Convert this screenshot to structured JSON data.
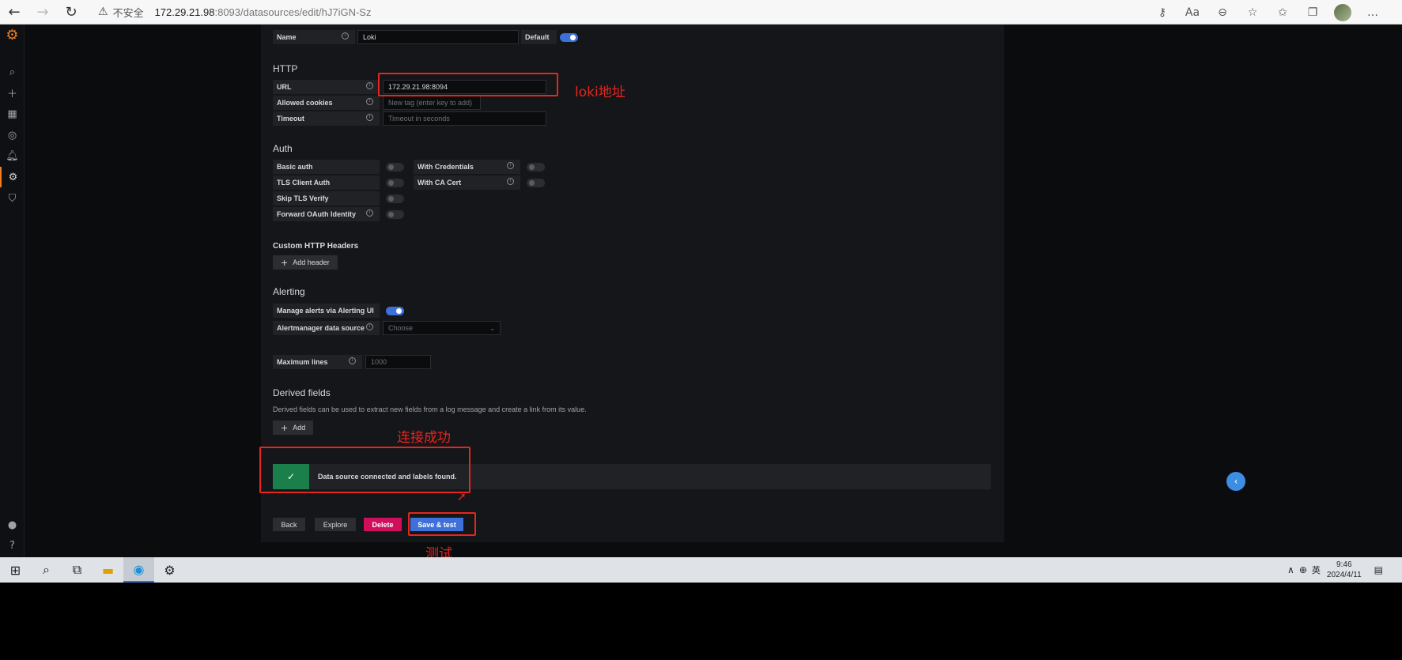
{
  "browser": {
    "back": "←",
    "forward": "→",
    "reload": "↻",
    "warning_icon": "warning-triangle-icon",
    "insecure_label": "不安全",
    "url_host": "172.29.21.98",
    "url_path": ":8093/datasources/edit/hJ7iGN-Sz",
    "tools": [
      "key-icon",
      "read-aloud-icon",
      "zoom-icon",
      "favorite-add-icon",
      "favorites-icon",
      "collections-icon",
      "profile-icon",
      "more-icon"
    ],
    "more": "…"
  },
  "sidemenu": {
    "items": [
      "search-icon",
      "add-icon",
      "dashboards-icon",
      "explore-icon",
      "alerting-icon",
      "configuration-icon",
      "server-admin-icon",
      "user-icon",
      "help-icon"
    ]
  },
  "form": {
    "name_label": "Name",
    "name_value": "Loki",
    "default_label": "Default",
    "http_title": "HTTP",
    "url_label": "URL",
    "url_value": "172.29.21.98:8094",
    "cookies_label": "Allowed cookies",
    "cookies_placeholder": "New tag (enter key to add)",
    "timeout_label": "Timeout",
    "timeout_placeholder": "Timeout in seconds",
    "auth_title": "Auth",
    "basic_auth": "Basic auth",
    "with_credentials": "With Credentials",
    "tls_client_auth": "TLS Client Auth",
    "with_ca_cert": "With CA Cert",
    "skip_tls": "Skip TLS Verify",
    "forward_oauth": "Forward OAuth Identity",
    "custom_headers_title": "Custom HTTP Headers",
    "add_header": "Add header",
    "alerting_title": "Alerting",
    "manage_alerts": "Manage alerts via Alerting UI",
    "alertmanager_ds": "Alertmanager data source",
    "alertmanager_placeholder": "Choose",
    "max_lines_label": "Maximum lines",
    "max_lines_placeholder": "1000",
    "derived_title": "Derived fields",
    "derived_desc": "Derived fields can be used to extract new fields from a log message and create a link from its value.",
    "add": "Add",
    "alert_message": "Data source connected and labels found.",
    "back": "Back",
    "explore": "Explore",
    "delete": "Delete",
    "save_test": "Save & test"
  },
  "annotations": {
    "loki_address": "loki地址",
    "connected": "连接成功",
    "test": "测试"
  },
  "taskbar": {
    "items": [
      "windows-start-icon",
      "search-icon",
      "task-view-icon",
      "file-explorer-icon",
      "edge-icon",
      "settings-icon"
    ],
    "ime": "英",
    "time": "9:46",
    "date": "2024/4/11"
  },
  "colors": {
    "accent": "#3d71d9",
    "success": "#1a7f4b",
    "danger": "#d10e5c",
    "annotation": "#e5261f",
    "grafana_orange": "#f17d1e"
  }
}
